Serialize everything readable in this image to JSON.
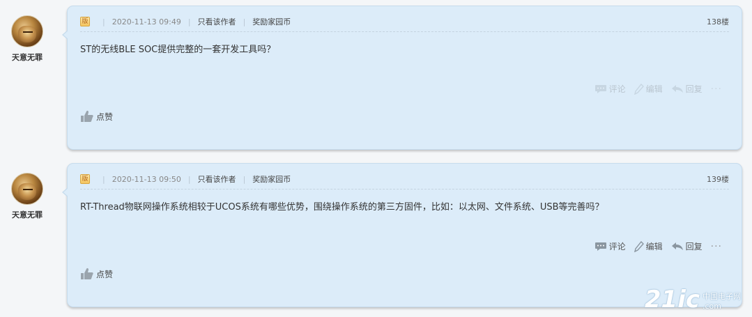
{
  "posts": [
    {
      "author": "天意无罪",
      "badge": "版",
      "date": "2020-11-13 09:49",
      "only_author": "只看该作者",
      "reward": "奖励家园币",
      "floor": "138楼",
      "content": "ST的无线BLE SOC提供完整的一套开发工具吗？",
      "comment": "评论",
      "edit": "编辑",
      "reply": "回复",
      "more": "···",
      "like": "点赞"
    },
    {
      "author": "天意无罪",
      "badge": "版",
      "date": "2020-11-13 09:50",
      "only_author": "只看该作者",
      "reward": "奖励家园币",
      "floor": "139楼",
      "content": "RT-Thread物联网操作系统相较于UCOS系统有哪些优势，围绕操作系统的第三方固件，比如：以太网、文件系统、USB等完善吗？",
      "comment": "评论",
      "edit": "编辑",
      "reply": "回复",
      "more": "···",
      "like": "点赞"
    }
  ],
  "separator": "|",
  "watermark": {
    "main": "21ic",
    "cn": "中国电子网",
    "domain": ".com"
  }
}
